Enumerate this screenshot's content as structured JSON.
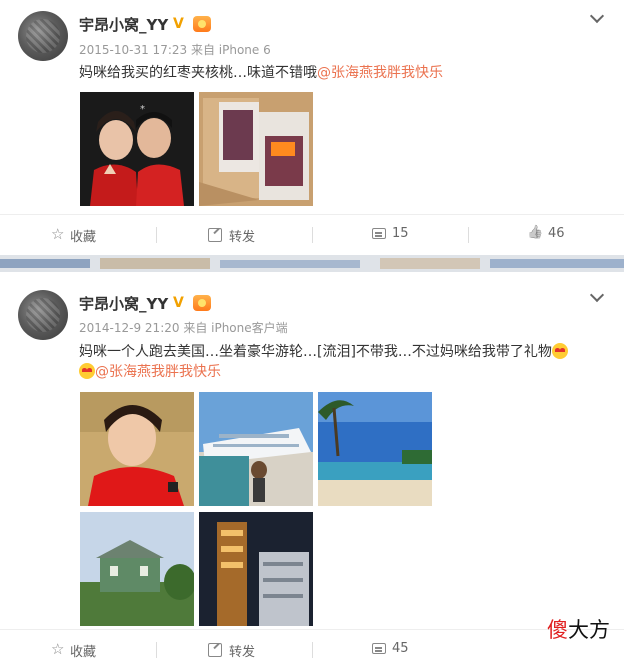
{
  "posts": [
    {
      "username": "宇昂小窝_YY",
      "verified_badge": "V",
      "meta": "2015-10-31 17:23 来自 iPhone 6",
      "text_plain": "妈咪给我买的红枣夹核桃…味道不错哦",
      "mention": "@张海燕我胖我快乐",
      "actions": {
        "favorite": "收藏",
        "forward": "转发",
        "comment": "15",
        "like": "46"
      }
    },
    {
      "username": "宇昂小窝_YY",
      "verified_badge": "V",
      "meta": "2014-12-9 21:20 来自 iPhone客户端",
      "text_line1": "妈咪一个人跑去美国…坐着豪华游轮…[流泪]不带我…不过妈咪给我带了礼物",
      "mention": "@张海燕我胖我快乐",
      "actions": {
        "favorite": "收藏",
        "forward": "转发",
        "comment": "45"
      }
    }
  ],
  "watermark": {
    "first_char": "傻",
    "rest": "大方"
  },
  "icons": {
    "more": "chevron-down-icon",
    "favorite": "star-icon",
    "forward": "forward-icon",
    "comment": "comment-icon",
    "like": "like-icon"
  },
  "colors": {
    "mention": "#eb7350",
    "badge_v": "#f2a100",
    "watermark_red": "#e02020"
  }
}
